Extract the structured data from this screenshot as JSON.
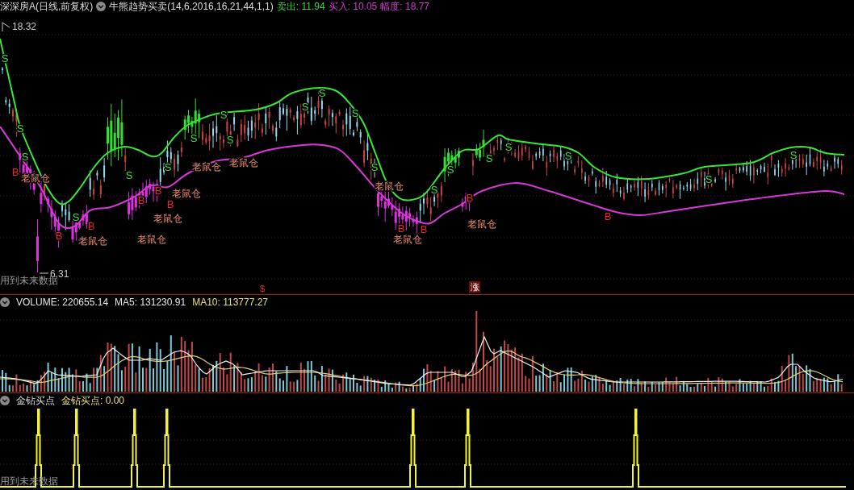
{
  "main_pane": {
    "security": "深深房A(日线,前复权)",
    "indicator": "牛熊趋势买卖(14,6,2016,16,21,44,1,1)",
    "readouts": [
      {
        "label": "卖出:",
        "value": "11.94",
        "color": "#3cd83c"
      },
      {
        "label": "买入:",
        "value": "10.05",
        "color": "#d23cd2"
      },
      {
        "label": "幅度:",
        "value": "18.77",
        "color": "#d23cd2"
      }
    ],
    "price_high": "18.32",
    "price_low": "6.31",
    "sell_marks": [
      "S",
      "S",
      "S",
      "S",
      "S",
      "S",
      "S",
      "S",
      "S",
      "S",
      "S",
      "S",
      "S",
      "S",
      "S",
      "S",
      "S",
      "S",
      "S",
      "S"
    ],
    "buy_marks": [
      "B",
      "B",
      "B",
      "B",
      "B",
      "B",
      "B",
      "B",
      "B",
      "B"
    ],
    "rat_labels": [
      "老鼠仓",
      "老鼠仓",
      "老鼠仓",
      "老鼠仓",
      "老鼠仓",
      "老鼠仓",
      "老鼠仓",
      "老鼠仓",
      "老鼠仓",
      "老鼠仓"
    ],
    "warning": "用到未来数据",
    "event_marks": [
      {
        "kind": "plain",
        "text": "$"
      },
      {
        "kind": "boxed",
        "text": "涨"
      }
    ]
  },
  "volume_pane": {
    "readouts": [
      {
        "label": "VOLUME:",
        "value": "220655.14",
        "color": "#e6e6e6"
      },
      {
        "label": "MA5:",
        "value": "131230.91",
        "color": "#e6e6e6"
      },
      {
        "label": "MA10:",
        "value": "113777.27",
        "color": "#e6e07a"
      }
    ]
  },
  "signal_pane": {
    "title": "金钻买点",
    "readouts": [
      {
        "label": "金钻买点:",
        "value": "0.00",
        "color": "#e6e07a"
      }
    ],
    "warning": "用到未来数据"
  }
}
